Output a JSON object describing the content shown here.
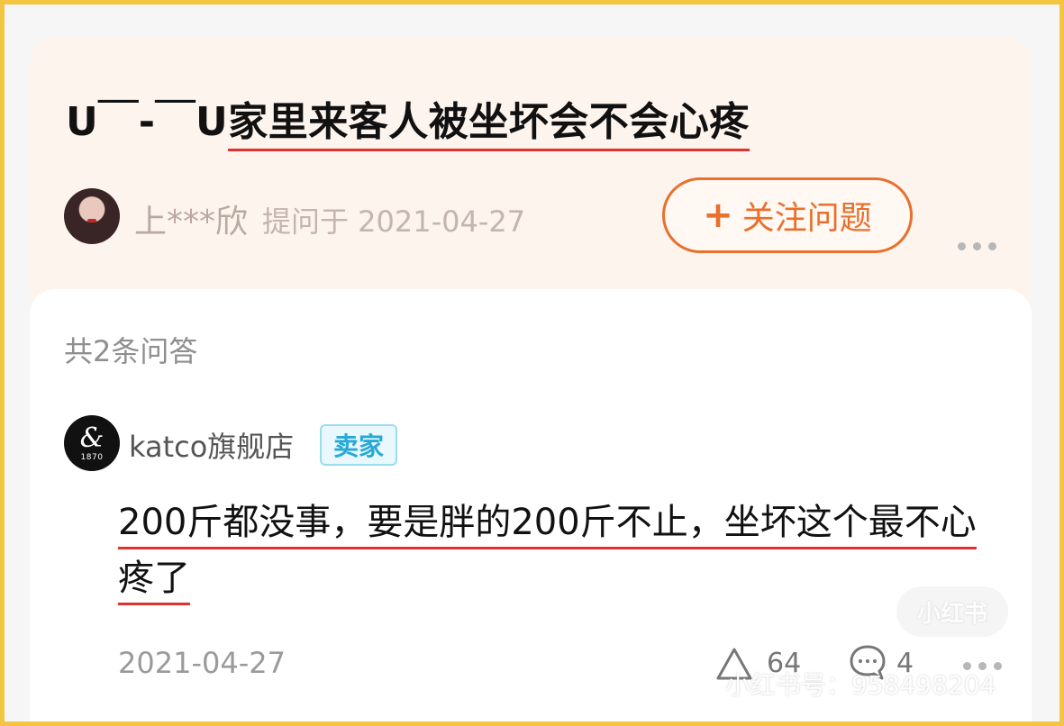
{
  "question": {
    "title_prefix": "U￣-￣U",
    "title_main": "家里来客人被坐坏会不会心疼",
    "asker_name": "上***欣",
    "asked_meta": "提问于 2021-04-27",
    "follow_button": "关注问题",
    "follow_icon": "+"
  },
  "answers": {
    "count_label": "共2条问答",
    "items": [
      {
        "shop_name": "katco旗舰店",
        "shop_avatar_glyph": "&",
        "shop_avatar_year": "1870",
        "badge": "卖家",
        "text": "200斤都没事，要是胖的200斤不止，坐坏这个最不心疼了",
        "date": "2021-04-27",
        "likes": "64",
        "comments": "4"
      }
    ]
  },
  "watermark": {
    "logo": "小红书",
    "id_text": "小红书号：958498204"
  },
  "colors": {
    "accent": "#e8702c",
    "underline": "#e0322f",
    "badge": "#27a9d6",
    "frame": "#f4c542"
  }
}
